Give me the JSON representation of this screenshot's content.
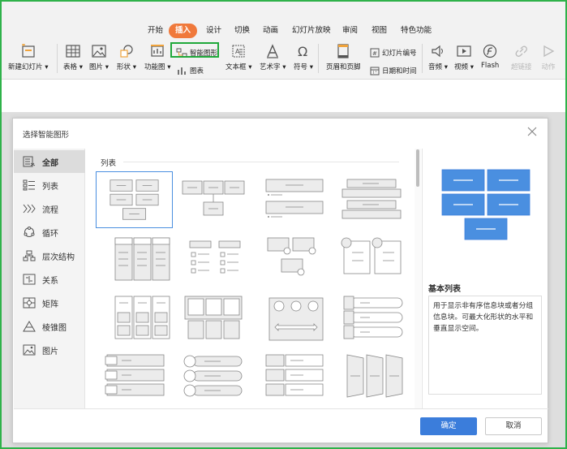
{
  "ribbon": {
    "tabs": [
      "开始",
      "插入",
      "设计",
      "切换",
      "动画",
      "幻灯片放映",
      "审阅",
      "视图",
      "特色功能"
    ],
    "active_tab": "插入",
    "tools": {
      "new_slide": "新建幻灯片",
      "table": "表格",
      "picture": "图片",
      "shape": "形状",
      "function_chart": "功能图",
      "smart_art": "智能图形",
      "chart": "图表",
      "textbox": "文本框",
      "wordart": "艺术字",
      "symbol": "符号",
      "header_footer": "页眉和页脚",
      "slide_number": "幻灯片编号",
      "date_time": "日期和时间",
      "audio": "音频",
      "video": "视频",
      "flash": "Flash",
      "hyperlink": "超链接",
      "action": "动作"
    }
  },
  "dialog": {
    "title": "选择智能图形",
    "categories": [
      {
        "label": "全部",
        "icon": "all-icon"
      },
      {
        "label": "列表",
        "icon": "list-icon"
      },
      {
        "label": "流程",
        "icon": "process-icon"
      },
      {
        "label": "循环",
        "icon": "cycle-icon"
      },
      {
        "label": "层次结构",
        "icon": "hierarchy-icon"
      },
      {
        "label": "关系",
        "icon": "relationship-icon"
      },
      {
        "label": "矩阵",
        "icon": "matrix-icon"
      },
      {
        "label": "棱锥图",
        "icon": "pyramid-icon"
      },
      {
        "label": "图片",
        "icon": "picture-icon"
      }
    ],
    "active_category": "全部",
    "section_label": "列表",
    "selected_name": "基本列表",
    "description": "用于显示非有序信息块或者分组信息块。可最大化形状的水平和垂直显示空间。",
    "ok_label": "确定",
    "cancel_label": "取消"
  },
  "colors": {
    "accent_blue": "#3b7ddb",
    "tab_orange": "#f0793b",
    "highlight_green": "#1fa83a"
  }
}
